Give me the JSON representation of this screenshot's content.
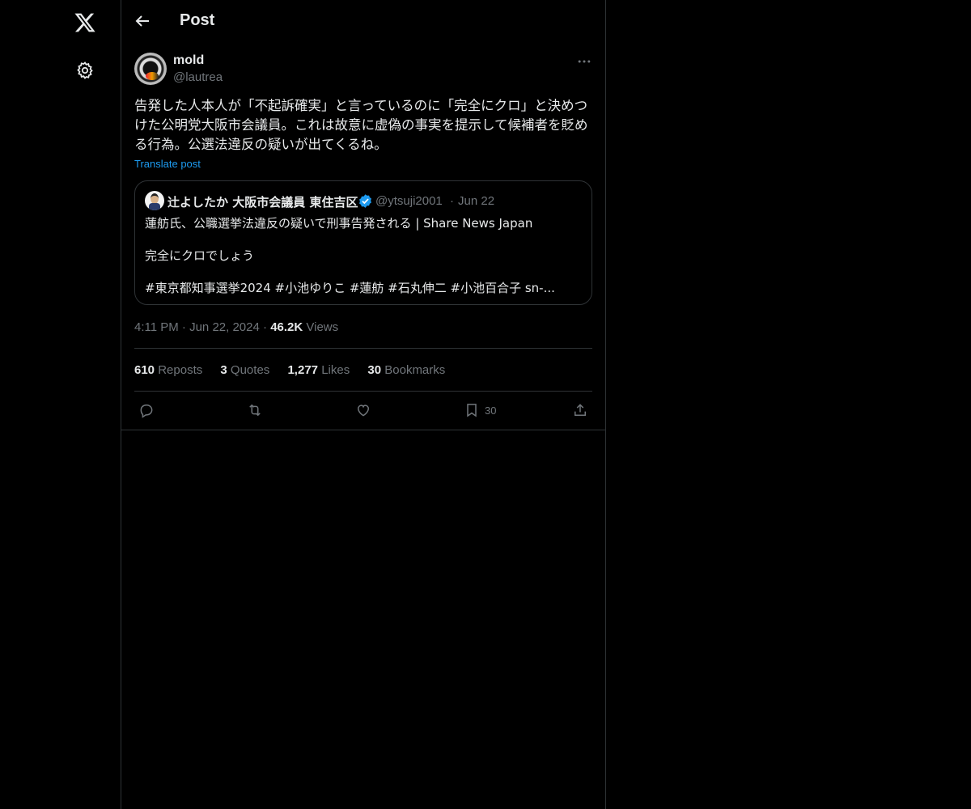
{
  "header": {
    "title": "Post"
  },
  "post": {
    "author_name": "mold",
    "author_handle": "@lautrea",
    "text": "告発した人本人が「不起訴確実」と言っているのに「完全にクロ」と決めつけた公明党大阪市会議員。これは故意に虚偽の事実を提示して候補者を貶める行為。公選法違反の疑いが出てくるね。",
    "translate_label": "Translate post",
    "quote": {
      "author_name": "辻よしたか 大阪市会議員 東住吉区",
      "author_handle": "@ytsuji2001",
      "separator": "·",
      "date": "Jun 22",
      "line1": "蓮舫氏、公職選挙法違反の疑いで刑事告発される | Share News Japan",
      "line2": "完全にクロでしょう",
      "line3": "#東京都知事選挙2024  #小池ゆりこ #蓮舫 #石丸伸二 #小池百合子 sn-..."
    },
    "time": "4:11 PM",
    "date": "Jun 22, 2024",
    "views_count": "46.2K",
    "views_label": "Views",
    "separator": "·",
    "stats": {
      "reposts_count": "610",
      "reposts_label": "Reposts",
      "quotes_count": "3",
      "quotes_label": "Quotes",
      "likes_count": "1,277",
      "likes_label": "Likes",
      "bookmarks_count": "30",
      "bookmarks_label": "Bookmarks"
    },
    "actions": {
      "bookmark_count": "30"
    }
  },
  "icons": {
    "logo": "x-logo-icon",
    "settings": "gear-icon",
    "back": "arrow-left-icon",
    "more": "more-horizontal-icon",
    "verified": "verified-badge-icon",
    "reply": "reply-icon",
    "repost": "repost-icon",
    "like": "heart-icon",
    "bookmark": "bookmark-icon",
    "share": "share-icon"
  },
  "colors": {
    "background": "#000000",
    "text": "#e7e9ea",
    "muted": "#71767b",
    "accent": "#1d9bf0",
    "border": "#2f3336"
  }
}
